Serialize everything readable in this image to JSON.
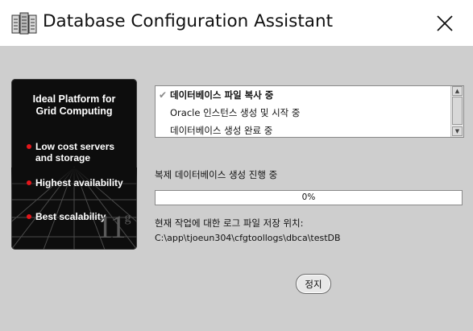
{
  "window": {
    "title": "Database Configuration Assistant",
    "icon": "database-server-icon",
    "close_icon": "close-icon"
  },
  "promo": {
    "title_line1": "Ideal Platform for",
    "title_line2": "Grid Computing",
    "bullets": [
      {
        "line1": "Low cost servers",
        "line2": "and storage"
      },
      {
        "line1": "Highest availability",
        "line2": ""
      },
      {
        "line1": "Best scalability",
        "line2": ""
      }
    ],
    "logo_main": "11",
    "logo_sup": "g",
    "bullet_color": "#e3161b"
  },
  "steps": [
    {
      "label": "데이터베이스 파일 복사 중",
      "done": true,
      "active": true
    },
    {
      "label": "Oracle 인스턴스 생성 및 시작 중",
      "done": false,
      "active": false
    },
    {
      "label": "데이터베이스 생성 완료 중",
      "done": false,
      "active": false
    }
  ],
  "status_text": "복제 데이터베이스 생성 진행 중",
  "progress": {
    "percent": 0,
    "label": "0%"
  },
  "log": {
    "label": "현재 작업에 대한 로그 파일 저장 위치:",
    "path": "C:\\app\\tjoeun304\\cfgtoollogs\\dbca\\testDB"
  },
  "buttons": {
    "stop": "정지"
  },
  "colors": {
    "client_bg": "#cecece",
    "progress_fill": "#6d88b4"
  }
}
